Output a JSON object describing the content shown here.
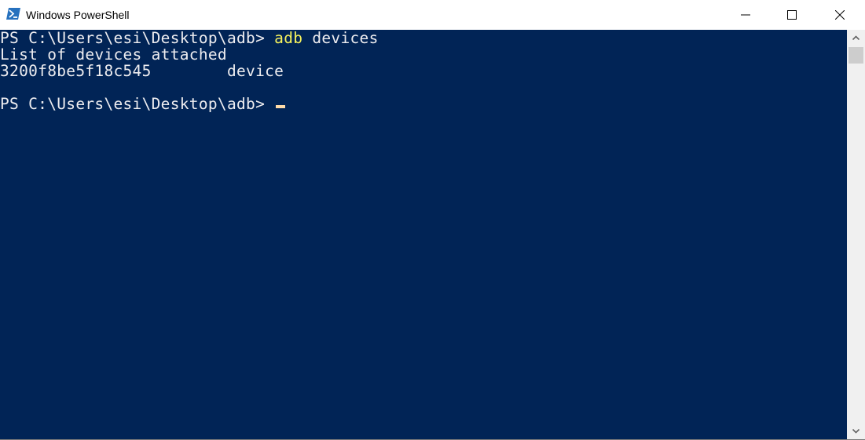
{
  "window": {
    "title": "Windows PowerShell",
    "icon": "powershell-icon",
    "controls": {
      "minimize": "minimize-icon",
      "maximize": "maximize-icon",
      "close": "close-icon"
    }
  },
  "console": {
    "colors": {
      "background": "#012456",
      "foreground": "#eeedf0",
      "command": "#f5f15d",
      "cursor": "#fedba9"
    },
    "lines": [
      {
        "prompt": "PS C:\\Users\\esi\\Desktop\\adb> ",
        "command": "adb",
        "args": " devices"
      },
      {
        "text": "List of devices attached"
      },
      {
        "text": "3200f8be5f18c545\tdevice"
      },
      {
        "text": ""
      },
      {
        "prompt": "PS C:\\Users\\esi\\Desktop\\adb> "
      }
    ]
  },
  "scrollbar": {
    "up": "chevron-up-icon",
    "down": "chevron-down-icon"
  }
}
